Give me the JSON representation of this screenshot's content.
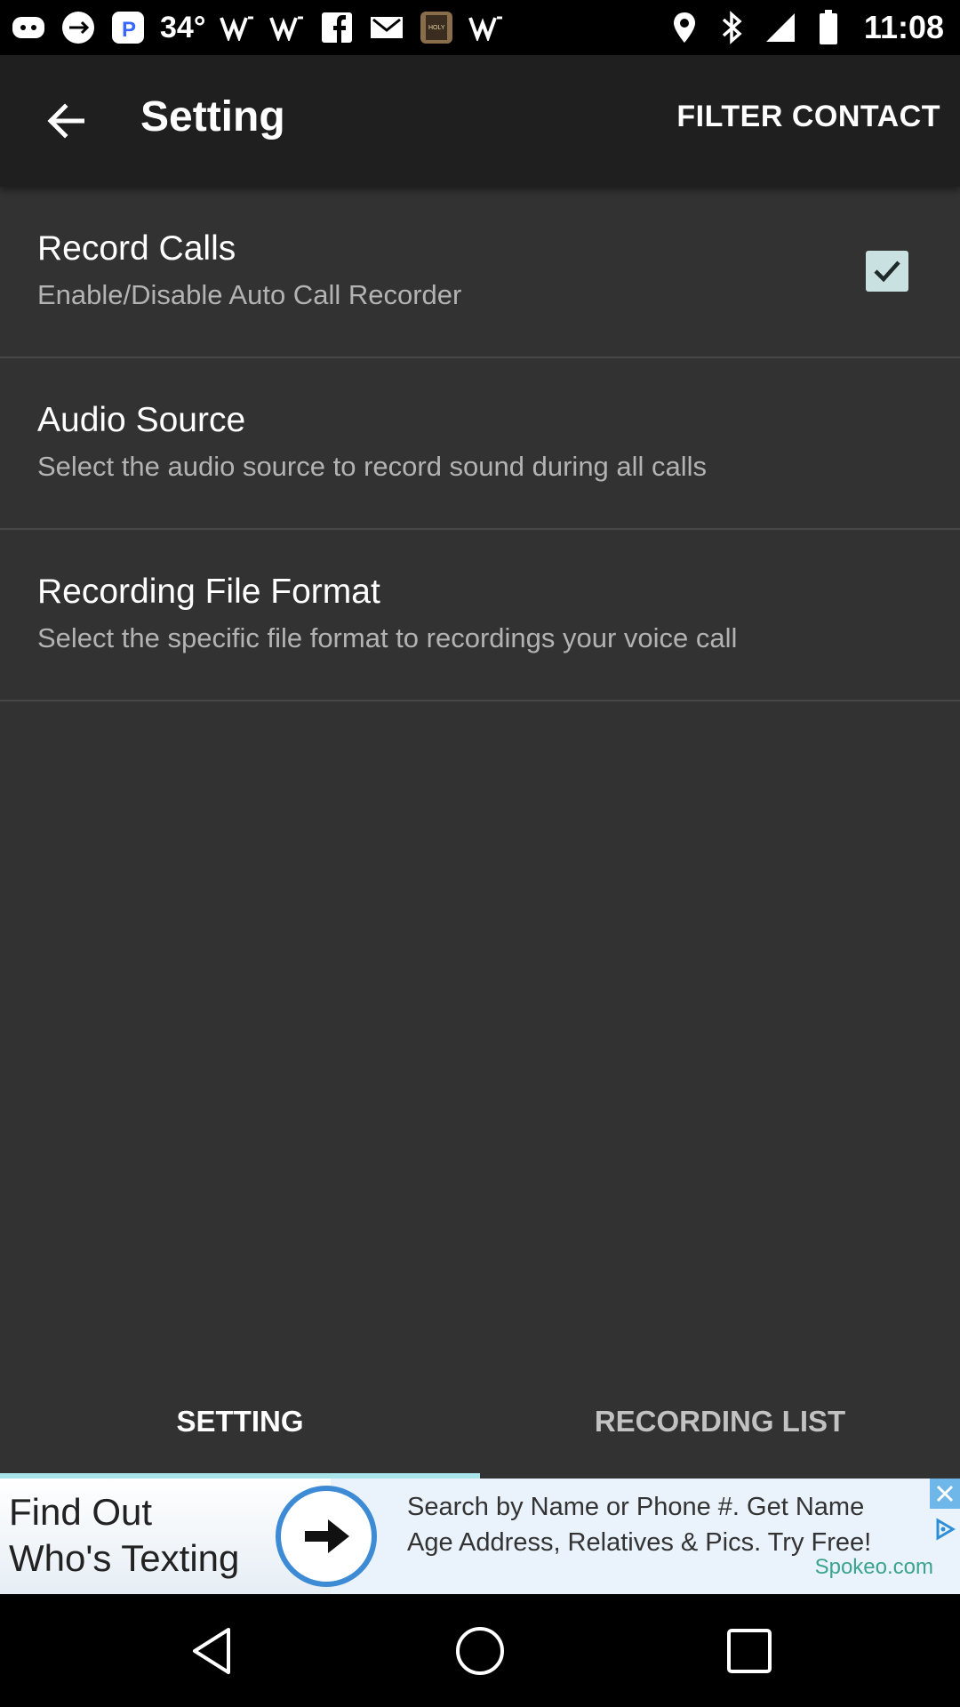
{
  "status_bar": {
    "temperature": "34°",
    "time": "11:08",
    "left_icons": [
      "discord-icon",
      "usb-icon",
      "pandora-icon",
      "temperature-text",
      "wifi-calling-icon",
      "wifi-calling-icon",
      "facebook-icon",
      "gmail-icon",
      "bible-app-icon",
      "wifi-calling-icon"
    ],
    "right_icons": [
      "location-icon",
      "bluetooth-icon",
      "signal-icon",
      "battery-icon"
    ]
  },
  "app_bar": {
    "title": "Setting",
    "action": "FILTER CONTACT"
  },
  "preferences": [
    {
      "title": "Record Calls",
      "summary": "Enable/Disable Auto Call Recorder",
      "checked": true
    },
    {
      "title": "Audio Source",
      "summary": "Select the audio source to record sound during all calls"
    },
    {
      "title": "Recording File Format",
      "summary": "Select the specific file format to recordings your voice call"
    }
  ],
  "tabs": [
    {
      "label": "SETTING",
      "selected": true
    },
    {
      "label": "RECORDING LIST",
      "selected": false
    }
  ],
  "ad": {
    "headline_line1": "Find Out",
    "headline_line2": "Who's Texting",
    "body_line1": "Search by Name or Phone #. Get Name",
    "body_line2": "Age Address, Relatives & Pics. Try Free!",
    "source": "Spokeo.com"
  },
  "colors": {
    "app_bar": "#1f1f1f",
    "background": "#323232",
    "accent": "#a9e4ea",
    "checkbox": "#c9e1e0"
  }
}
